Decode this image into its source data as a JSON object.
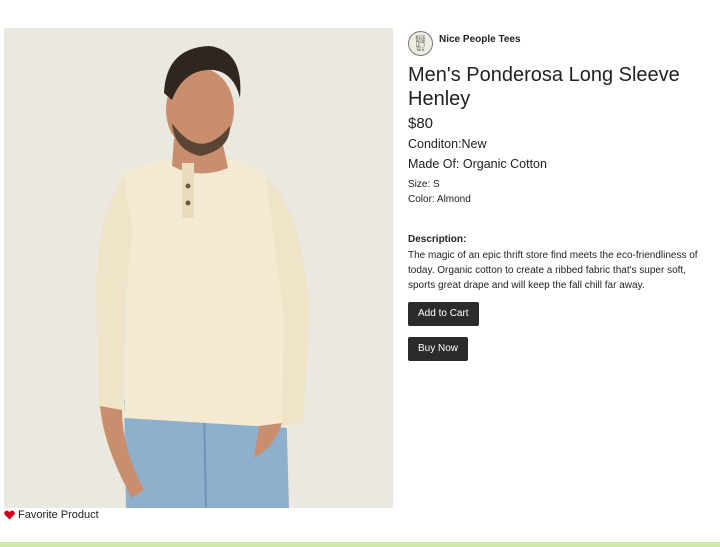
{
  "product": {
    "image_alt": "Man wearing cream long sleeve henley and jeans",
    "seller": {
      "name": "Nice People Tees",
      "logo_text": "NICE PEOPLE TEES"
    },
    "title": "Men's Ponderosa Long Sleeve Henley",
    "price": "$80",
    "condition": "Conditon:New",
    "made_of": "Made Of: Organic Cotton",
    "size": "Size: S",
    "color": "Color: Almond",
    "description_label": "Description:",
    "description": "The magic of an epic thrift store find meets the eco-friendliness of today. Organic cotton to create a ribbed fabric that's super soft, sports great drape and will keep the fall chill far away."
  },
  "actions": {
    "add_to_cart": "Add to Cart",
    "buy_now": "Buy Now",
    "favorite": "Favorite Product"
  },
  "colors": {
    "button_bg": "#2b2b2b",
    "heart": "#d0021b",
    "footer_bar": "#cfe8a6"
  }
}
